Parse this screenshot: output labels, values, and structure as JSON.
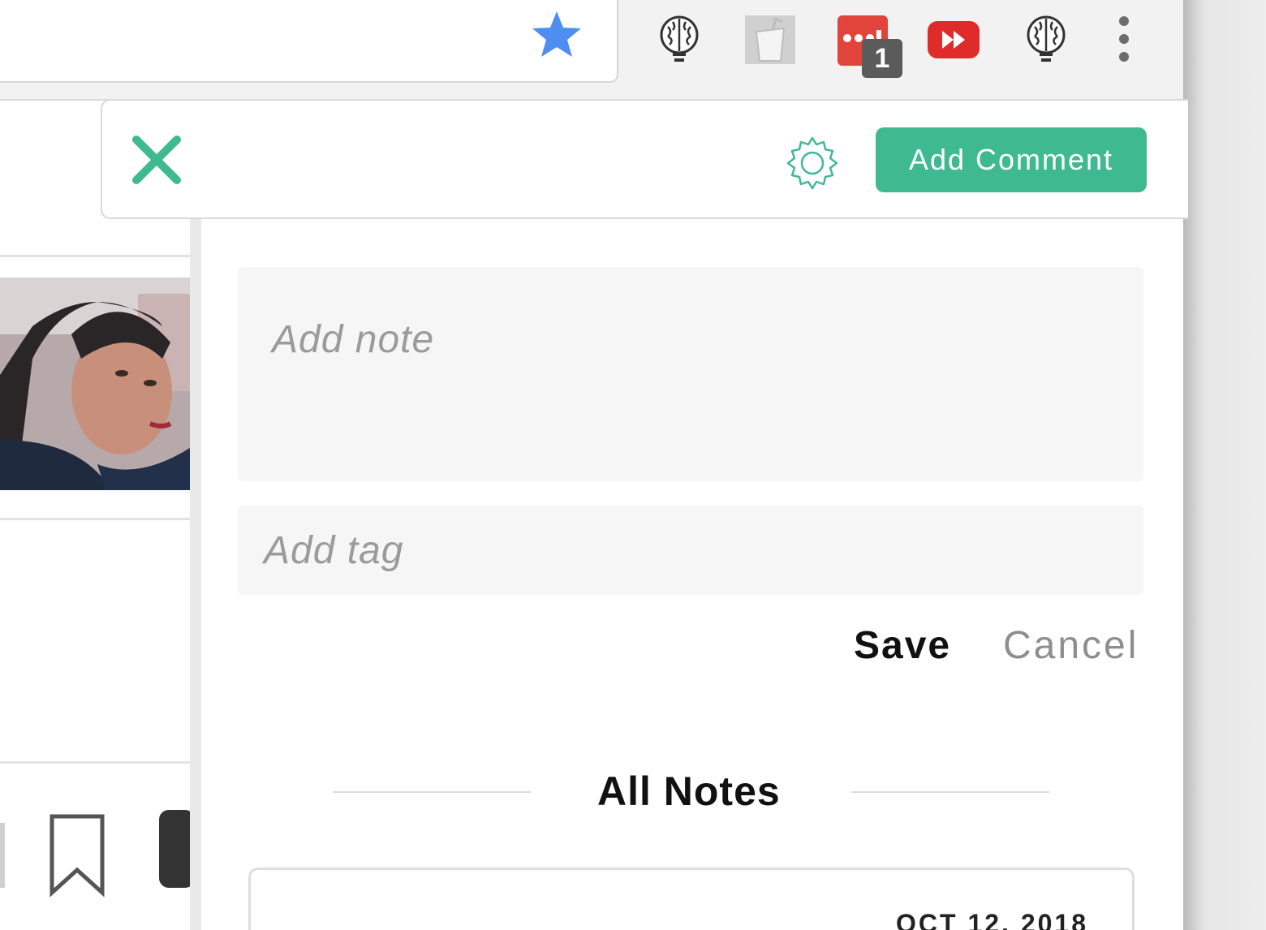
{
  "toolbar": {
    "bookmark_star_color": "#4d8ef0",
    "extensions": [
      {
        "name": "brain-icon"
      },
      {
        "name": "paper-cup-icon"
      },
      {
        "name": "red-dots-icon",
        "badge": "1"
      },
      {
        "name": "fast-forward-icon"
      },
      {
        "name": "brain-icon"
      }
    ]
  },
  "panel": {
    "header": {
      "add_comment_label": "Add Comment",
      "accent": "#3fba90"
    },
    "note": {
      "placeholder": "Add note"
    },
    "tag": {
      "placeholder": "Add tag"
    },
    "actions": {
      "save_label": "Save",
      "cancel_label": "Cancel"
    },
    "all_notes_title": "All Notes",
    "notes": [
      {
        "date": "OCT 12, 2018"
      }
    ]
  }
}
